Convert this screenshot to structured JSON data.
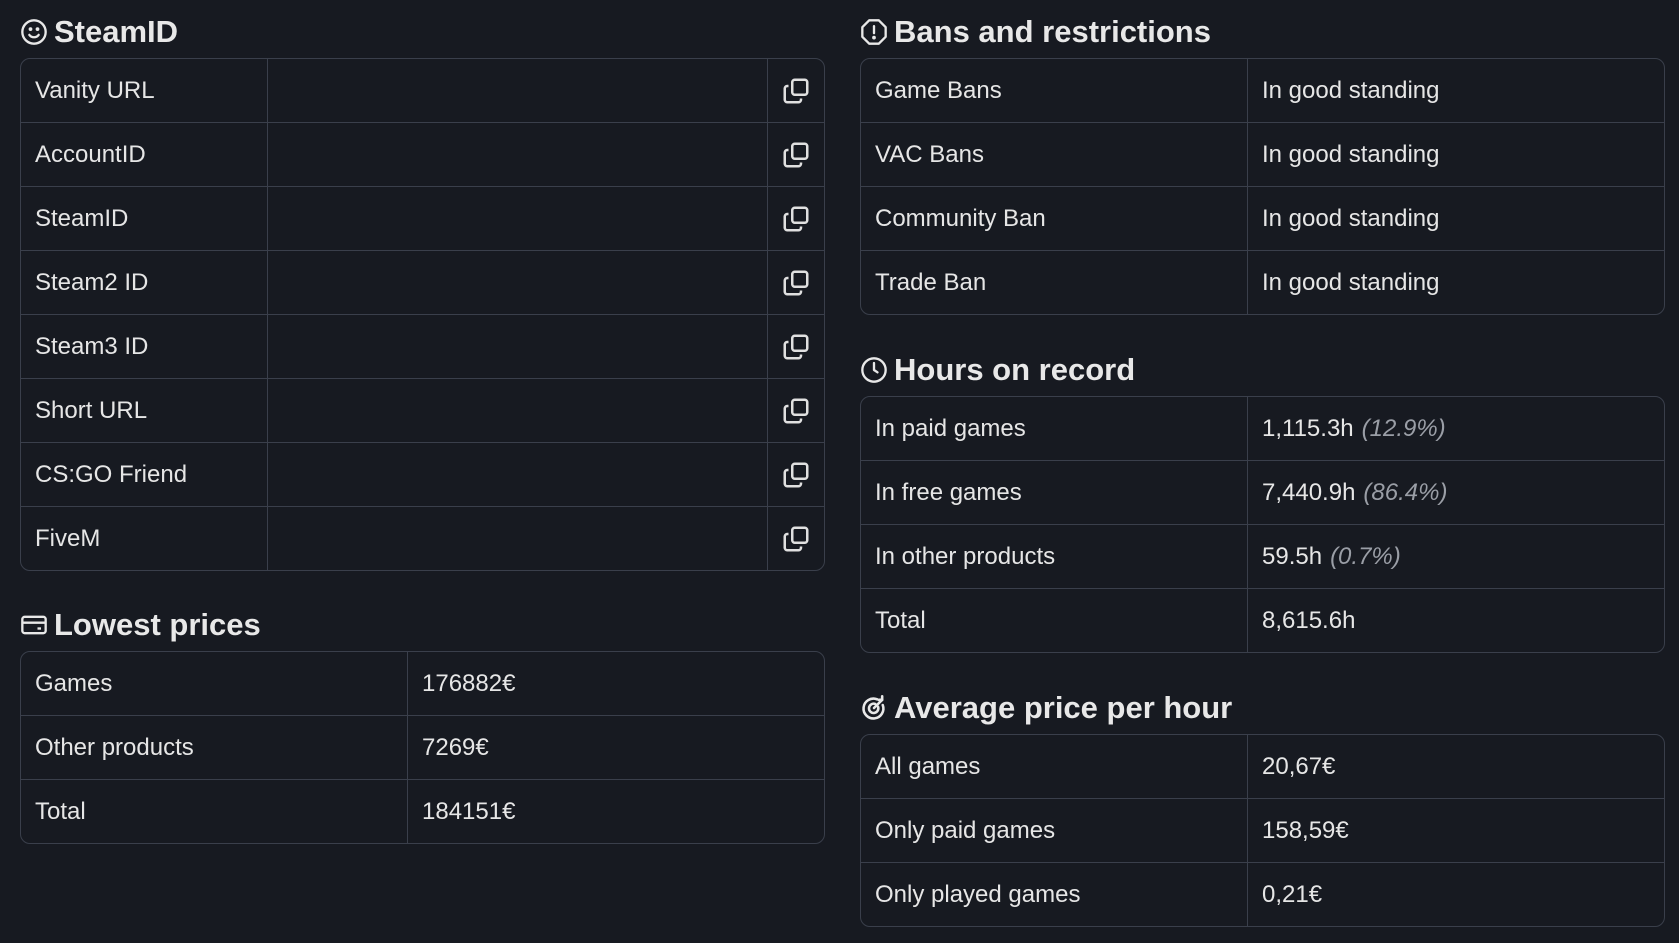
{
  "steamid": {
    "title": "SteamID",
    "icon": "smiley-icon",
    "rows": [
      {
        "label": "Vanity URL",
        "value": ""
      },
      {
        "label": "AccountID",
        "value": ""
      },
      {
        "label": "SteamID",
        "value": ""
      },
      {
        "label": "Steam2 ID",
        "value": ""
      },
      {
        "label": "Steam3 ID",
        "value": ""
      },
      {
        "label": "Short URL",
        "value": ""
      },
      {
        "label": "CS:GO Friend",
        "value": ""
      },
      {
        "label": "FiveM",
        "value": ""
      }
    ]
  },
  "lowest_prices": {
    "title": "Lowest prices",
    "icon": "credit-card-icon",
    "rows": [
      {
        "label": "Games",
        "value": "176882€"
      },
      {
        "label": "Other products",
        "value": "7269€"
      },
      {
        "label": "Total",
        "value": "184151€"
      }
    ]
  },
  "bans": {
    "title": "Bans and restrictions",
    "icon": "alert-octagon-icon",
    "rows": [
      {
        "label": "Game Bans",
        "value": "In good standing"
      },
      {
        "label": "VAC Bans",
        "value": "In good standing"
      },
      {
        "label": "Community Ban",
        "value": "In good standing"
      },
      {
        "label": "Trade Ban",
        "value": "In good standing"
      }
    ]
  },
  "hours": {
    "title": "Hours on record",
    "icon": "clock-icon",
    "rows": [
      {
        "label": "In paid games",
        "value": "1,115.3h",
        "pct": "(12.9%)"
      },
      {
        "label": "In free games",
        "value": "7,440.9h",
        "pct": "(86.4%)"
      },
      {
        "label": "In other products",
        "value": "59.5h",
        "pct": "(0.7%)"
      },
      {
        "label": "Total",
        "value": "8,615.6h",
        "pct": ""
      }
    ]
  },
  "avg_price": {
    "title": "Average price per hour",
    "icon": "target-icon",
    "rows": [
      {
        "label": "All games",
        "value": "20,67€"
      },
      {
        "label": "Only paid games",
        "value": "158,59€"
      },
      {
        "label": "Only played games",
        "value": "0,21€"
      }
    ]
  }
}
